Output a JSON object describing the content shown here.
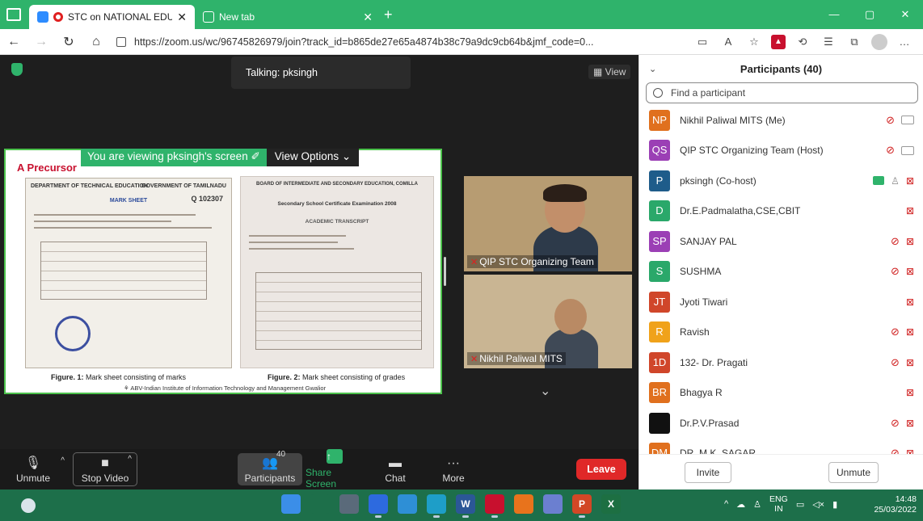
{
  "browser": {
    "tabs": [
      {
        "title": "STC on NATIONAL EDUCATI",
        "close": "✕"
      },
      {
        "title": "New tab",
        "close": "✕"
      }
    ],
    "new_tab": "+",
    "window_controls": [
      "—",
      "▢",
      "✕"
    ],
    "url": "https://zoom.us/wc/96745826979/join?track_id=b865de27e65a4874b38c79a9dc9cb64b&jmf_code=0...",
    "toolbar_icons": [
      "reader-icon",
      "read-aloud-icon",
      "favorite-icon",
      "pdf-icon",
      "extensions-icon",
      "favorites-bar-icon",
      "collections-icon",
      "profile-icon",
      "menu-icon"
    ]
  },
  "meeting": {
    "talking": "Talking: pksingh",
    "view_label": "View",
    "viewing_banner": "You are viewing pksingh's screen",
    "view_options": "View Options",
    "shared_slide": {
      "title": "A Precursor",
      "doc1_header_left": "DEPARTMENT OF TECHNICAL EDUCATION",
      "doc1_header_right": "GOVERNMENT OF TAMILNADU",
      "doc1_title": "MARK SHEET",
      "doc1_serial": "Q 102307",
      "doc2_header": "BOARD OF INTERMEDIATE AND SECONDARY EDUCATION, COMILLA",
      "doc2_title": "Secondary School Certificate Examination 2008",
      "doc2_subtitle": "ACADEMIC TRANSCRIPT",
      "caption1_bold": "Figure. 1:",
      "caption1": " Mark sheet consisting of marks",
      "caption2_bold": "Figure. 2:",
      "caption2": " Mark sheet consisting of grades",
      "footer": "ABV-Indian Institute of Information Technology and Management Gwalior"
    },
    "videos": [
      {
        "name": "QIP STC Organizing Team"
      },
      {
        "name": "Nikhil Paliwal MITS"
      }
    ]
  },
  "zoom_toolbar": {
    "unmute": "Unmute",
    "stop_video": "Stop Video",
    "participants": "Participants",
    "participants_count": "40",
    "share_screen": "Share Screen",
    "chat": "Chat",
    "more": "More",
    "leave": "Leave"
  },
  "participants_panel": {
    "title": "Participants (40)",
    "search_placeholder": "Find a participant",
    "invite": "Invite",
    "unmute": "Unmute",
    "list": [
      {
        "initials": "NP",
        "name": "Nikhil Paliwal MITS (Me)",
        "color": "#e0701e",
        "mic": "muted",
        "cam": "on"
      },
      {
        "initials": "QS",
        "name": "QIP STC Organizing Team (Host)",
        "color": "#9b3fb5",
        "mic": "muted",
        "cam": "on"
      },
      {
        "initials": "P",
        "name": "pksingh (Co-host)",
        "color": "#1e5c8a",
        "mic": "on",
        "cam": "off",
        "sharing": true
      },
      {
        "initials": "D",
        "name": "Dr.E.Padmalatha,CSE,CBIT",
        "color": "#2aa86a",
        "mic": "none",
        "cam": "off"
      },
      {
        "initials": "SP",
        "name": "SANJAY PAL",
        "color": "#9b3fb5",
        "mic": "muted",
        "cam": "off"
      },
      {
        "initials": "S",
        "name": "SUSHMA",
        "color": "#2aa86a",
        "mic": "muted",
        "cam": "off"
      },
      {
        "initials": "JT",
        "name": "Jyoti Tiwari",
        "color": "#d0462a",
        "mic": "none",
        "cam": "off"
      },
      {
        "initials": "R",
        "name": "Ravish",
        "color": "#f0a21a",
        "mic": "muted",
        "cam": "off"
      },
      {
        "initials": "1D",
        "name": "132- Dr. Pragati",
        "color": "#d0462a",
        "mic": "muted",
        "cam": "off"
      },
      {
        "initials": "BR",
        "name": "Bhagya R",
        "color": "#e0701e",
        "mic": "none",
        "cam": "off"
      },
      {
        "initials": "",
        "name": "Dr.P.V.Prasad",
        "color": "#111111",
        "mic": "muted",
        "cam": "off"
      },
      {
        "initials": "DM",
        "name": "DR. M.K. SAGAR",
        "color": "#e0701e",
        "mic": "muted",
        "cam": "off"
      }
    ]
  },
  "taskbar": {
    "apps": [
      {
        "label": "",
        "color": "#3b8ee8"
      },
      {
        "label": "",
        "color": "#1d6f4a"
      },
      {
        "label": "",
        "color": "#5a6a7a"
      },
      {
        "label": "",
        "color": "#2d6adf"
      },
      {
        "label": "",
        "color": "#2e8fd6"
      },
      {
        "label": "",
        "color": "#1e9ec8"
      },
      {
        "label": "W",
        "color": "#2b5797"
      },
      {
        "label": "",
        "color": "#c8102e"
      },
      {
        "label": "",
        "color": "#e8731c"
      },
      {
        "label": "",
        "color": "#6b7fd0"
      },
      {
        "label": "P",
        "color": "#d24726"
      },
      {
        "label": "X",
        "color": "#1d6f42"
      }
    ],
    "lang_top": "ENG",
    "lang_bottom": "IN",
    "time": "14:48",
    "date": "25/03/2022"
  }
}
